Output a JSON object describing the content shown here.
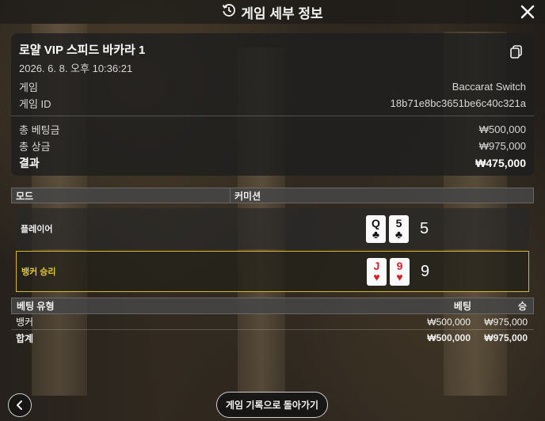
{
  "header": {
    "title": "게임 세부 정보",
    "history_icon": "history-clock-icon",
    "close_icon": "close-icon"
  },
  "summary": {
    "room": "로얄 VIP 스피드 바카라 1",
    "datetime": "2026. 6. 8. 오후 10:36:21",
    "copy_icon": "copy-icon",
    "game_label": "게임",
    "game_value": "Baccarat Switch",
    "game_id_label": "게임 ID",
    "game_id_value": "18b71e8bc3651be6c40c321a",
    "total_bet_label": "총 베팅금",
    "total_bet_value": "₩500,000",
    "total_win_label": "총 상금",
    "total_win_value": "₩975,000",
    "result_label": "결과",
    "result_value": "₩475,000"
  },
  "mode_bar": {
    "mode_label": "모드",
    "commission_label": "커미션"
  },
  "outcomes": {
    "player": {
      "label": "플레이어",
      "cards": [
        {
          "rank": "Q",
          "suit": "♣",
          "color": "black"
        },
        {
          "rank": "5",
          "suit": "♣",
          "color": "black"
        }
      ],
      "score": "5"
    },
    "banker": {
      "label": "뱅커 승리",
      "cards": [
        {
          "rank": "J",
          "suit": "♥",
          "color": "red"
        },
        {
          "rank": "9",
          "suit": "♥",
          "color": "red"
        }
      ],
      "score": "9",
      "highlight_color": "#d9b92a"
    }
  },
  "bets": {
    "headers": {
      "type": "베팅 유형",
      "bet": "베팅",
      "win": "승"
    },
    "rows": [
      {
        "type": "뱅커",
        "bet": "₩500,000",
        "win": "₩975,000"
      }
    ],
    "total": {
      "type": "합계",
      "bet": "₩500,000",
      "win": "₩975,000"
    }
  },
  "footer": {
    "back_icon": "chevron-left-icon",
    "history_button": "게임 기록으로 돌아가기"
  }
}
